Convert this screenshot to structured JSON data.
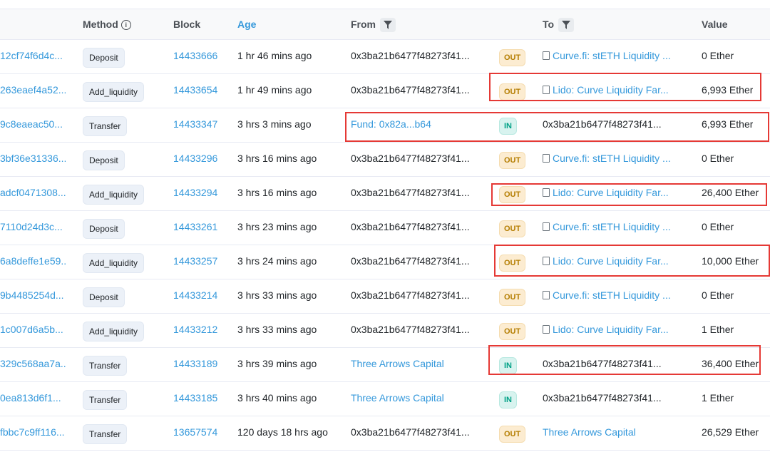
{
  "columns": {
    "method": "Method",
    "block": "Block",
    "age": "Age",
    "from": "From",
    "to": "To",
    "value": "Value"
  },
  "rows": [
    {
      "hash": "12cf74f6d4c...",
      "method": "Deposit",
      "block": "14433666",
      "age": "1 hr 46 mins ago",
      "from": "0x3ba21b6477f48273f41...",
      "dir": "OUT",
      "to": "Curve.fi: stETH Liquidity ...",
      "value": "0 Ether"
    },
    {
      "hash": "263eaef4a52...",
      "method": "Add_liquidity",
      "block": "14433654",
      "age": "1 hr 49 mins ago",
      "from": "0x3ba21b6477f48273f41...",
      "dir": "OUT",
      "to": "Lido: Curve Liquidity Far...",
      "value": "6,993 Ether"
    },
    {
      "hash": "9c8eaeac50...",
      "method": "Transfer",
      "block": "14433347",
      "age": "3 hrs 3 mins ago",
      "from": "Fund: 0x82a...b64",
      "dir": "IN",
      "to": "0x3ba21b6477f48273f41...",
      "value": "6,993 Ether"
    },
    {
      "hash": "3bf36e31336...",
      "method": "Deposit",
      "block": "14433296",
      "age": "3 hrs 16 mins ago",
      "from": "0x3ba21b6477f48273f41...",
      "dir": "OUT",
      "to": "Curve.fi: stETH Liquidity ...",
      "value": "0 Ether"
    },
    {
      "hash": "adcf0471308...",
      "method": "Add_liquidity",
      "block": "14433294",
      "age": "3 hrs 16 mins ago",
      "from": "0x3ba21b6477f48273f41...",
      "dir": "OUT",
      "to": "Lido: Curve Liquidity Far...",
      "value": "26,400 Ether"
    },
    {
      "hash": "7110d24d3c...",
      "method": "Deposit",
      "block": "14433261",
      "age": "3 hrs 23 mins ago",
      "from": "0x3ba21b6477f48273f41...",
      "dir": "OUT",
      "to": "Curve.fi: stETH Liquidity ...",
      "value": "0 Ether"
    },
    {
      "hash": "6a8deffe1e59...",
      "method": "Add_liquidity",
      "block": "14433257",
      "age": "3 hrs 24 mins ago",
      "from": "0x3ba21b6477f48273f41...",
      "dir": "OUT",
      "to": "Lido: Curve Liquidity Far...",
      "value": "10,000 Ether"
    },
    {
      "hash": "9b4485254d...",
      "method": "Deposit",
      "block": "14433214",
      "age": "3 hrs 33 mins ago",
      "from": "0x3ba21b6477f48273f41...",
      "dir": "OUT",
      "to": "Curve.fi: stETH Liquidity ...",
      "value": "0 Ether"
    },
    {
      "hash": "1c007d6a5b...",
      "method": "Add_liquidity",
      "block": "14433212",
      "age": "3 hrs 33 mins ago",
      "from": "0x3ba21b6477f48273f41...",
      "dir": "OUT",
      "to": "Lido: Curve Liquidity Far...",
      "value": "1 Ether"
    },
    {
      "hash": "329c568aa7a...",
      "method": "Transfer",
      "block": "14433189",
      "age": "3 hrs 39 mins ago",
      "from": "Three Arrows Capital",
      "dir": "IN",
      "to": "0x3ba21b6477f48273f41...",
      "value": "36,400 Ether"
    },
    {
      "hash": "0ea813d6f1...",
      "method": "Transfer",
      "block": "14433185",
      "age": "3 hrs 40 mins ago",
      "from": "Three Arrows Capital",
      "dir": "IN",
      "to": "0x3ba21b6477f48273f41...",
      "value": "1 Ether"
    },
    {
      "hash": "fbbc7c9ff116...",
      "method": "Transfer",
      "block": "13657574",
      "age": "120 days 18 hrs ago",
      "from": "0x3ba21b6477f48273f41...",
      "dir": "OUT",
      "to": "Three Arrows Capital",
      "value": "26,529 Ether"
    }
  ]
}
